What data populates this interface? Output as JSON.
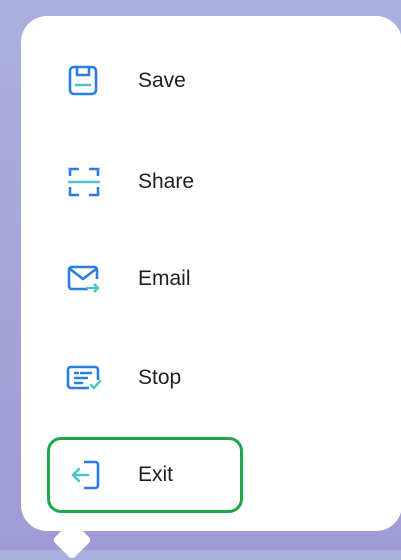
{
  "menu": {
    "items": [
      {
        "label": "Save",
        "icon": "save-icon"
      },
      {
        "label": "Share",
        "icon": "share-icon"
      },
      {
        "label": "Email",
        "icon": "email-icon"
      },
      {
        "label": "Stop",
        "icon": "stop-icon"
      },
      {
        "label": "Exit",
        "icon": "exit-icon"
      }
    ],
    "highlighted_item": "Exit"
  },
  "colors": {
    "icon_blue": "#2a7de1",
    "icon_teal": "#4dc3c7",
    "highlight_border": "#1fa64a",
    "text": "#1e1e1e"
  }
}
